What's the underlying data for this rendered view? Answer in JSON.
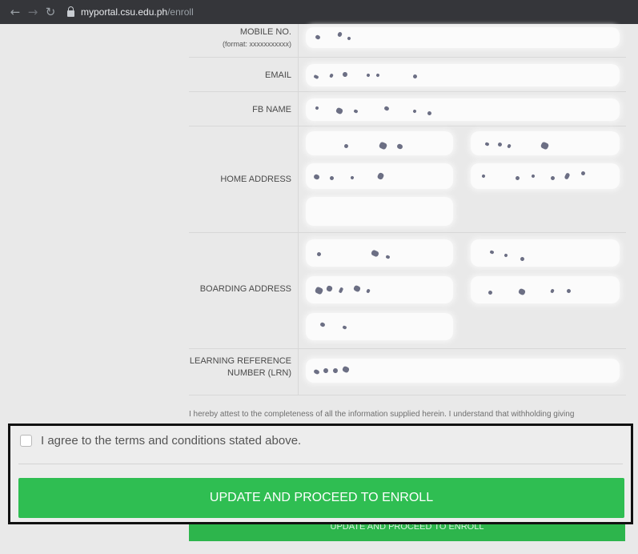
{
  "browser": {
    "back_icon": "←",
    "forward_icon": "→",
    "reload_icon": "↻",
    "url_host": "myportal.csu.edu.ph",
    "url_path": "/enroll"
  },
  "form": {
    "mobile_label": "MOBILE NO.",
    "mobile_format": "(format: xxxxxxxxxxx)",
    "email_label": "EMAIL",
    "fb_label": "FB NAME",
    "home_address_label": "HOME ADDRESS",
    "boarding_address_label": "BOARDING ADDRESS",
    "lrn_label_line1": "LEARNING REFERENCE",
    "lrn_label_line2": "NUMBER (LRN)"
  },
  "attestation": "I hereby attest to the completeness of all the information supplied herein. I understand that withholding giving",
  "agreement": {
    "checkbox_checked": false,
    "label": "I agree to the terms and conditions stated above."
  },
  "submit_label": "UPDATE AND PROCEED TO ENROLL",
  "colors": {
    "button_green": "#2fbe52",
    "browser_bar": "#35363a",
    "highlight_border": "#111111"
  }
}
